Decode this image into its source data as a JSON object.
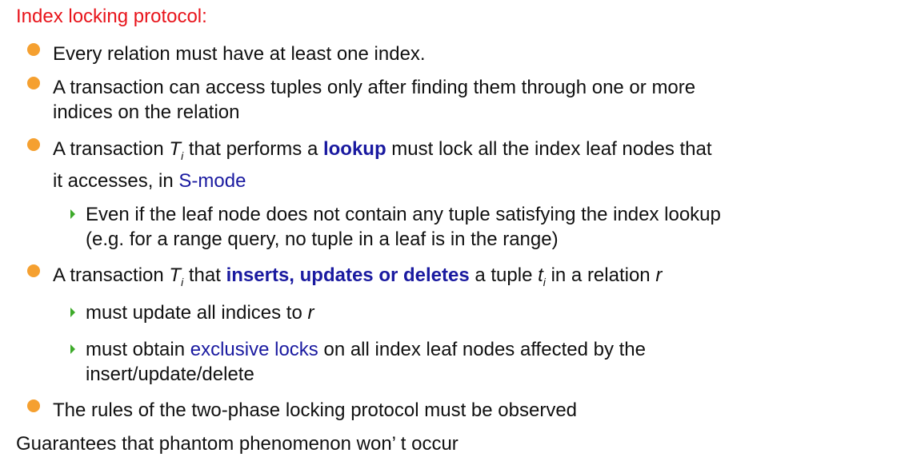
{
  "heading": "Index locking protocol:",
  "bullets": {
    "b1": "Every relation must have at least one index.",
    "b2": {
      "line1": "A transaction can access tuples only after finding them through one or more",
      "line2": "indices on the relation"
    },
    "b3": {
      "t1": "A transaction ",
      "var": "T",
      "var_sub": "i",
      "t2": " that performs a ",
      "kw": "lookup",
      "t3": " must lock all the index leaf nodes that",
      "t4": "it accesses, in ",
      "kw2": "S-mode"
    },
    "b3_sub1": {
      "line1": "Even if the leaf node does not contain any tuple satisfying the index lookup",
      "line2": "(e.g. for a range query, no tuple in a leaf is in the range)"
    },
    "b4": {
      "t1": "A transaction ",
      "var": "T",
      "var_sub": "i",
      "t2": " that ",
      "kw": "inserts, updates or deletes",
      "t3": " a tuple ",
      "var2": "t",
      "var2_sub": "i",
      "t4": " in a relation ",
      "var3": "r"
    },
    "b4_sub1": {
      "t1": "must update all indices to ",
      "var": "r"
    },
    "b4_sub2": {
      "t1": "must obtain ",
      "kw": "exclusive locks",
      "t2": " on all index leaf nodes affected by the",
      "line2": "insert/update/delete"
    },
    "b5": "The rules of the two-phase locking protocol must be observed"
  },
  "footer": "Guarantees that phantom phenomenon won’ t occur",
  "colors": {
    "heading": "#e8141b",
    "keyword": "#1a1aa0",
    "bullet_dot": "#f5a030",
    "sub_marker": "#3daa2a"
  }
}
